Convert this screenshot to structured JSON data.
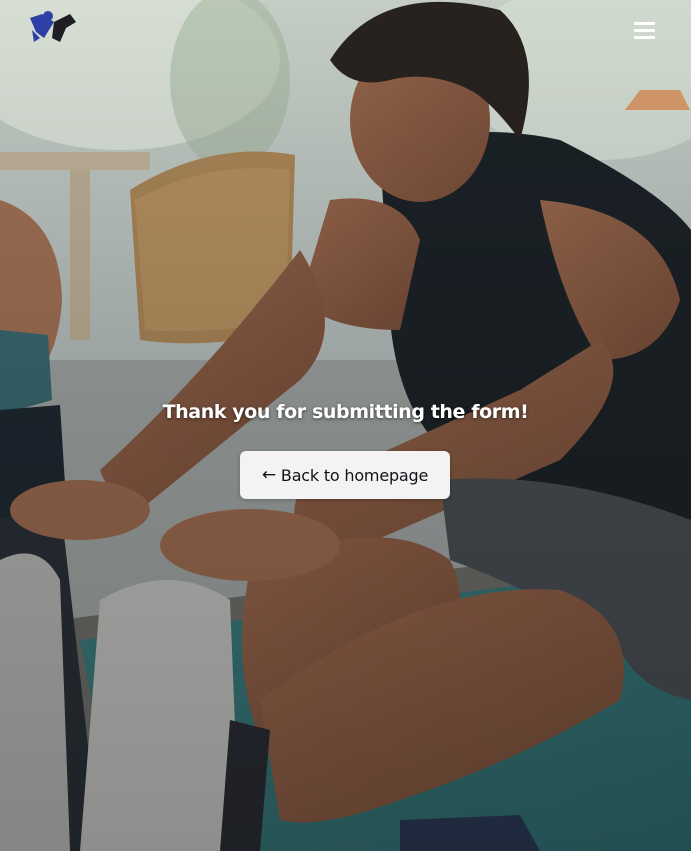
{
  "header": {
    "logo_icon": "weightlifter-logo-icon",
    "menu_icon": "hamburger-menu-icon"
  },
  "main": {
    "message": "Thank you for submitting the form!",
    "back_button": {
      "icon": "arrow-left-icon",
      "icon_glyph": "←",
      "label": "Back to homepage"
    }
  },
  "colors": {
    "accent": "#2e3fa8",
    "button_bg": "#f3f3f4",
    "text": "#ffffff"
  }
}
